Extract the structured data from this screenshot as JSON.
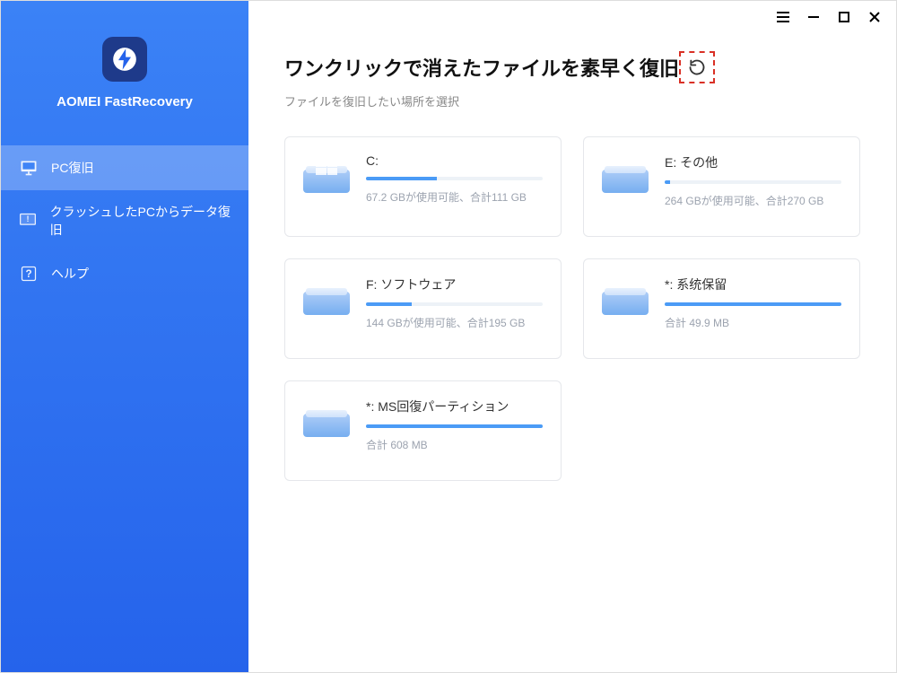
{
  "brand": {
    "name": "AOMEI FastRecovery"
  },
  "nav": {
    "items": [
      {
        "label": "PC復旧",
        "icon": "monitor",
        "active": true
      },
      {
        "label": "クラッシュしたPCからデータ復旧",
        "icon": "alert",
        "active": false
      },
      {
        "label": "ヘルプ",
        "icon": "help",
        "active": false
      }
    ]
  },
  "header": {
    "title": "ワンクリックで消えたファイルを素早く復旧",
    "subtitle": "ファイルを復旧したい場所を選択"
  },
  "drives": [
    {
      "label": "C:",
      "stats": "67.2 GBが使用可能、合計111 GB",
      "used_pct": 40,
      "is_windows": true
    },
    {
      "label": "E: その他",
      "stats": "264 GBが使用可能、合計270 GB",
      "used_pct": 3,
      "is_windows": false
    },
    {
      "label": "F: ソフトウェア",
      "stats": "144 GBが使用可能、合計195 GB",
      "used_pct": 26,
      "is_windows": false
    },
    {
      "label": "*: 系统保留",
      "stats": "合計 49.9 MB",
      "used_pct": 100,
      "is_windows": false
    },
    {
      "label": "*: MS回復パーティション",
      "stats": "合計 608 MB",
      "used_pct": 100,
      "is_windows": false
    }
  ]
}
